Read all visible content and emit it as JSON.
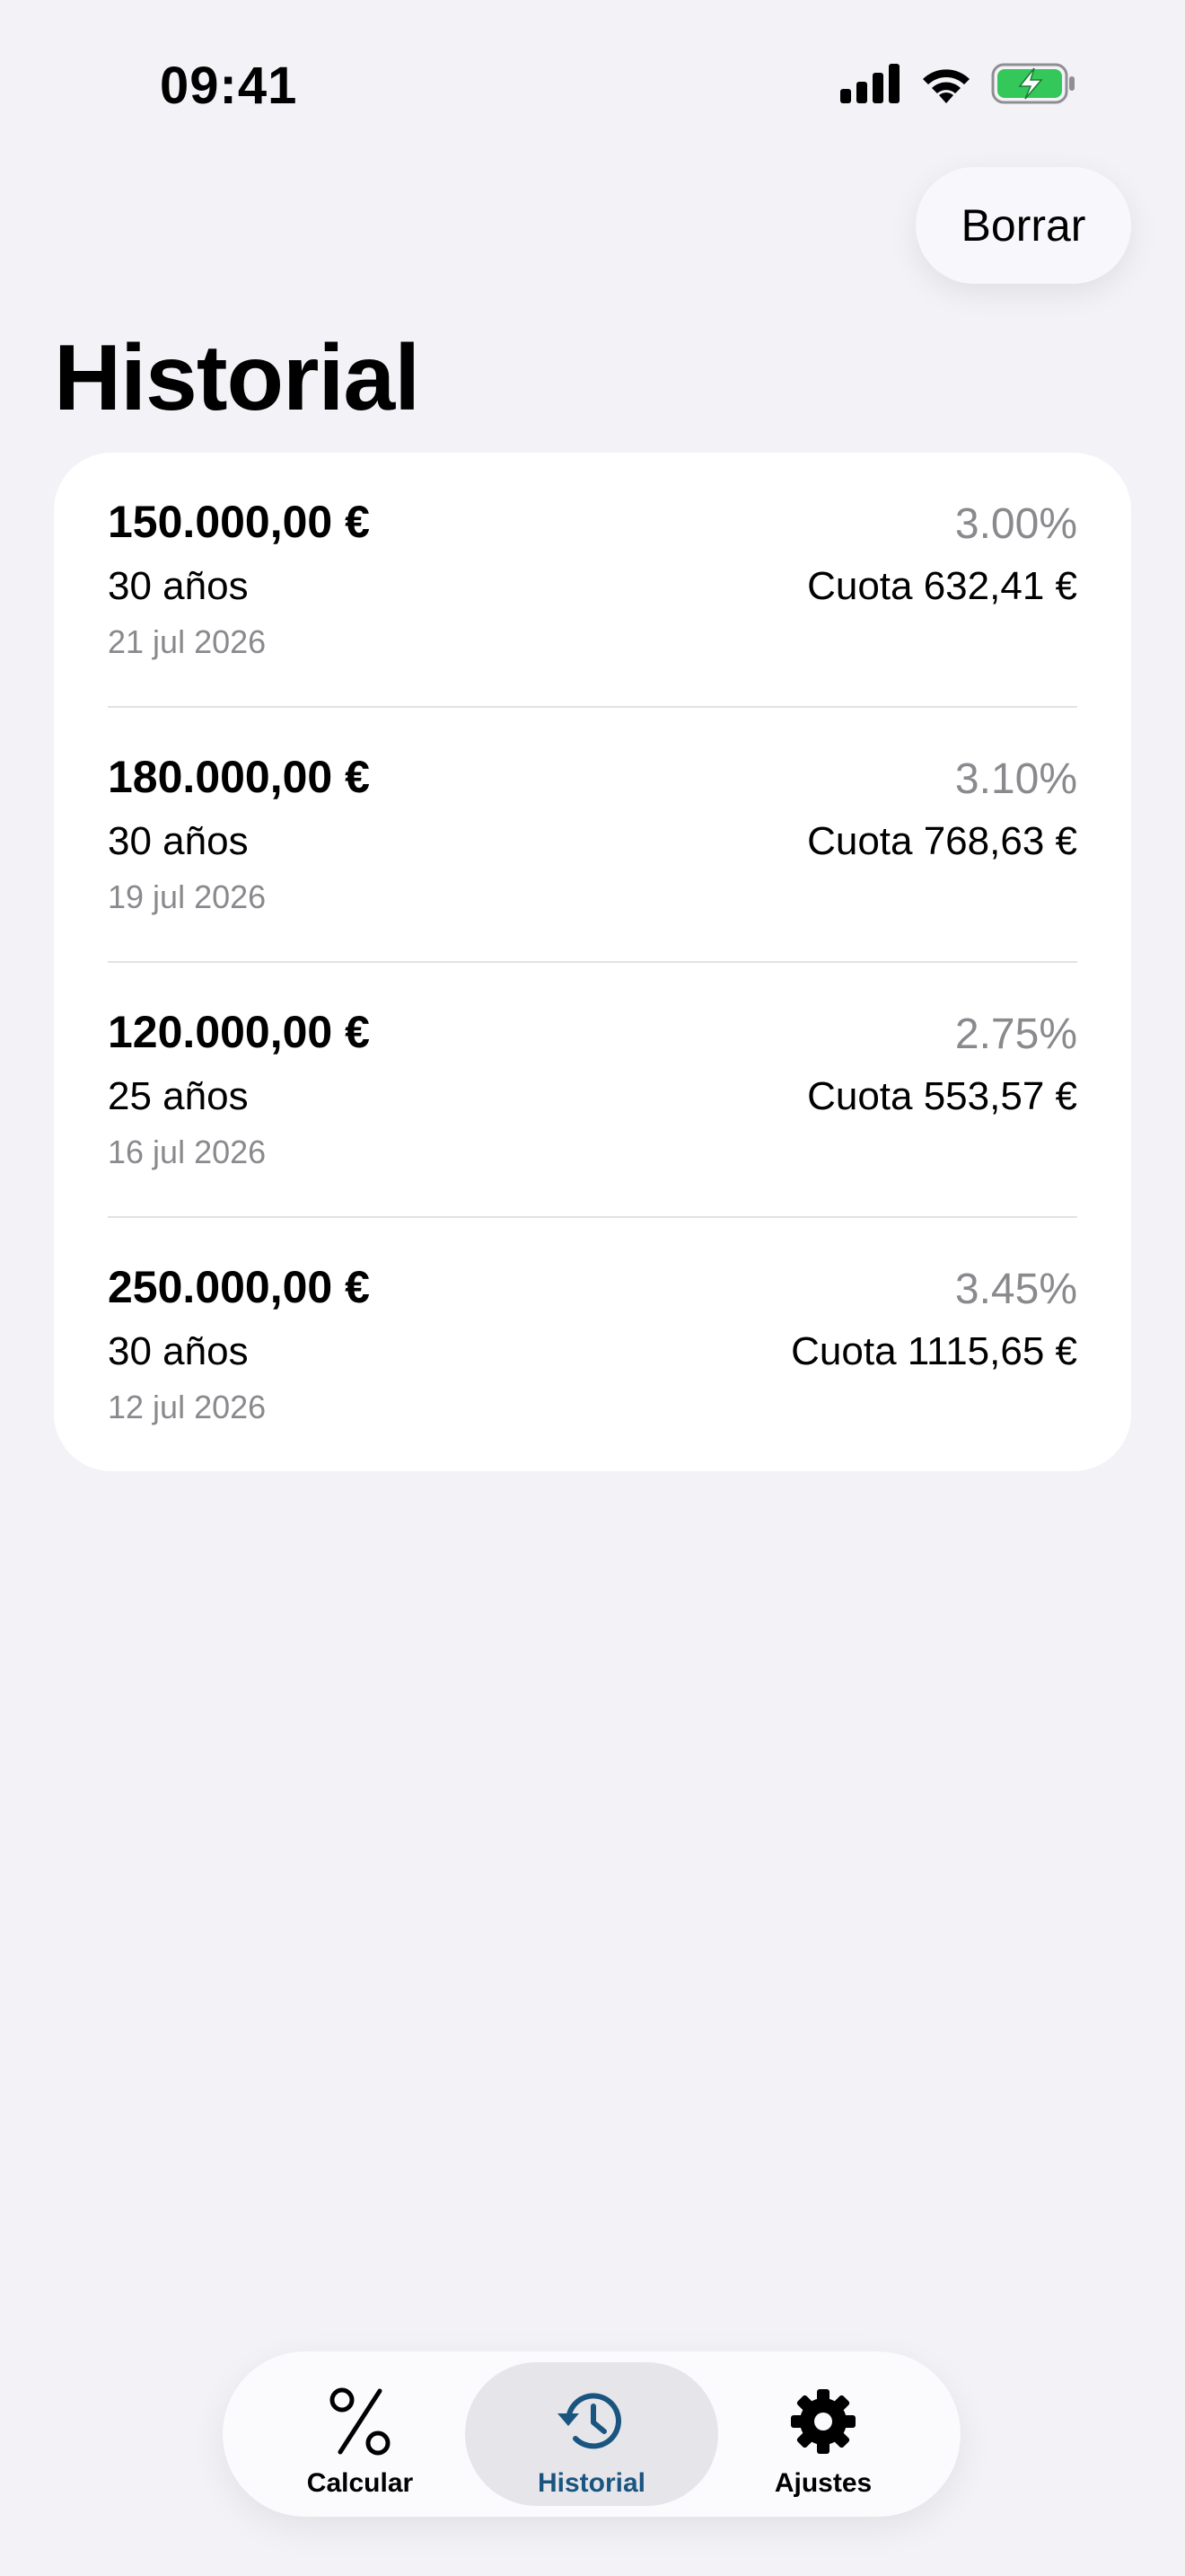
{
  "status_bar": {
    "time": "09:41",
    "icons": [
      "signal-icon",
      "wifi-icon",
      "battery-charging-icon"
    ],
    "battery_color": "#34c759"
  },
  "header": {
    "clear_label": "Borrar",
    "title": "Historial"
  },
  "history": [
    {
      "amount": "150.000,00 €",
      "years": "30 años",
      "date": "21 jul 2026",
      "rate": "3.00%",
      "cuota": "Cuota 632,41 €"
    },
    {
      "amount": "180.000,00 €",
      "years": "30 años",
      "date": "19 jul 2026",
      "rate": "3.10%",
      "cuota": "Cuota 768,63 €"
    },
    {
      "amount": "120.000,00 €",
      "years": "25 años",
      "date": "16 jul 2026",
      "rate": "2.75%",
      "cuota": "Cuota 553,57 €"
    },
    {
      "amount": "250.000,00 €",
      "years": "30 años",
      "date": "12 jul 2026",
      "rate": "3.45%",
      "cuota": "Cuota 1115,65 €"
    }
  ],
  "tabs": [
    {
      "label": "Calcular",
      "icon": "percent-icon",
      "active": false
    },
    {
      "label": "Historial",
      "icon": "history-clock-icon",
      "active": true
    },
    {
      "label": "Ajustes",
      "icon": "gear-icon",
      "active": false
    }
  ],
  "colors": {
    "accent": "#1a5580",
    "background": "#f2f2f7",
    "secondary_text": "#8a8a8e"
  }
}
